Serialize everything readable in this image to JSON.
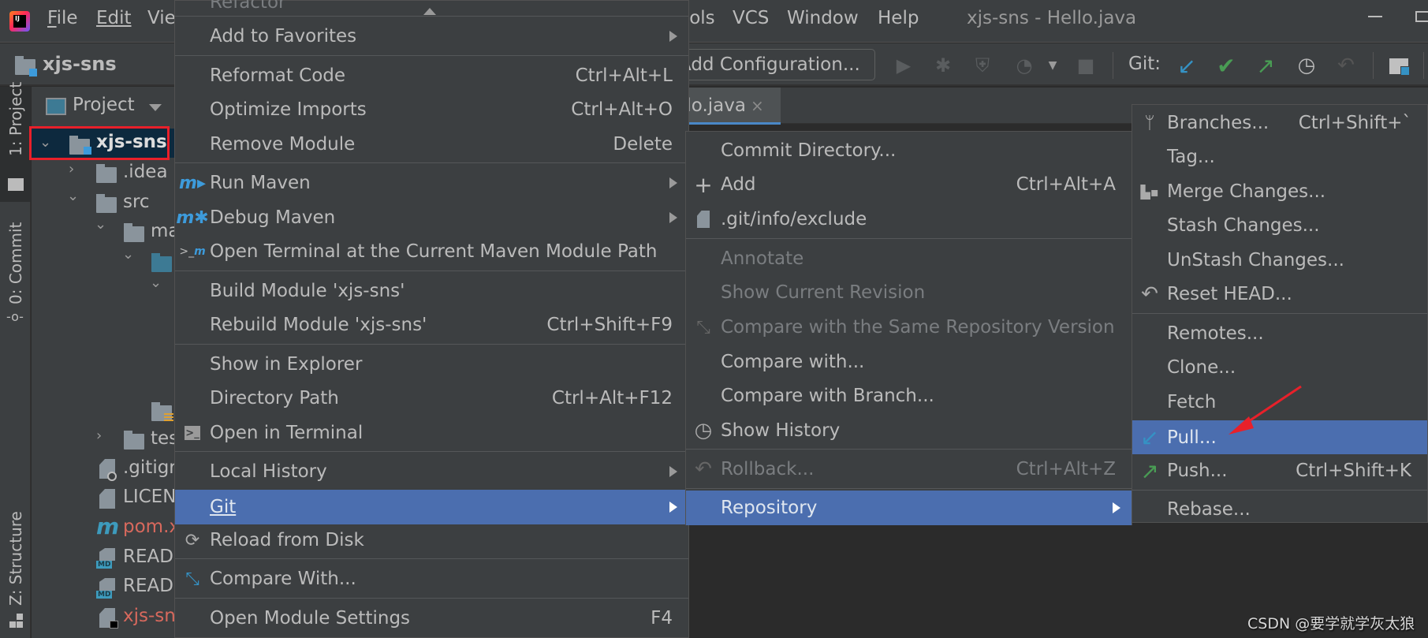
{
  "titlebar": {
    "menus": [
      {
        "label": "File",
        "mnemonic": "F"
      },
      {
        "label": "Edit",
        "mnemonic": "E"
      },
      {
        "label": "View",
        "mnemonic": "V"
      },
      {
        "label": "Tools",
        "mnemonic": "T"
      },
      {
        "label": "VCS",
        "mnemonic": "S"
      },
      {
        "label": "Window",
        "mnemonic": "W"
      },
      {
        "label": "Help",
        "mnemonic": "H"
      }
    ],
    "window_title": "xjs-sns - Hello.java"
  },
  "navbar": {
    "project_name": "xjs-sns",
    "add_configuration": "Add Configuration...",
    "git_label": "Git:"
  },
  "left_strip": {
    "project_tab": "1: Project",
    "commit_tab": "0: Commit",
    "structure_tab": "Z: Structure"
  },
  "project_panel": {
    "header": "Project",
    "root": "xjs-sns",
    "nodes": [
      {
        "label": ".idea",
        "type": "folder"
      },
      {
        "label": "src",
        "type": "folder"
      },
      {
        "label": "ma",
        "type": "folder"
      },
      {
        "label": "tes",
        "type": "folder"
      },
      {
        "label": ".gitigr",
        "type": "file"
      },
      {
        "label": "LICEN",
        "type": "file"
      },
      {
        "label": "pom.x",
        "type": "maven"
      },
      {
        "label": "READ",
        "type": "md"
      },
      {
        "label": "READ",
        "type": "md"
      },
      {
        "label": "xjs-sn",
        "type": "file"
      }
    ]
  },
  "editor": {
    "tab_label": "llo.java",
    "tab_close": "×"
  },
  "context_menu": {
    "scrolled_item": "Refactor",
    "items": [
      {
        "label": "Add to Favorites",
        "submenu": true
      },
      {
        "label": "Reformat Code",
        "shortcut": "Ctrl+Alt+L"
      },
      {
        "label": "Optimize Imports",
        "shortcut": "Ctrl+Alt+O"
      },
      {
        "label": "Remove Module",
        "shortcut": "Delete"
      },
      {
        "label": "Run Maven",
        "submenu": true,
        "icon": "maven-run-icon"
      },
      {
        "label": "Debug Maven",
        "submenu": true,
        "icon": "maven-debug-icon"
      },
      {
        "label": "Open Terminal at the Current Maven Module Path",
        "icon": "maven-terminal-icon"
      },
      {
        "label": "Build Module 'xjs-sns'"
      },
      {
        "label": "Rebuild Module 'xjs-sns'",
        "shortcut": "Ctrl+Shift+F9"
      },
      {
        "label": "Show in Explorer"
      },
      {
        "label": "Directory Path",
        "shortcut": "Ctrl+Alt+F12"
      },
      {
        "label": "Open in Terminal",
        "icon": "terminal-icon"
      },
      {
        "label": "Local History",
        "submenu": true
      },
      {
        "label": "Git",
        "submenu": true,
        "selected": true
      },
      {
        "label": "Reload from Disk",
        "icon": "reload-icon"
      },
      {
        "label": "Compare With...",
        "icon": "compare-icon"
      },
      {
        "label": "Open Module Settings",
        "shortcut": "F4"
      }
    ]
  },
  "git_menu": {
    "items": [
      {
        "label": "Commit Directory..."
      },
      {
        "label": "Add",
        "shortcut": "Ctrl+Alt+A",
        "icon": "plus-icon"
      },
      {
        "label": ".git/info/exclude",
        "icon": "ignored-file-icon"
      },
      {
        "label": "Annotate",
        "disabled": true
      },
      {
        "label": "Show Current Revision",
        "disabled": true
      },
      {
        "label": "Compare with the Same Repository Version",
        "disabled": true,
        "icon": "compare-icon"
      },
      {
        "label": "Compare with..."
      },
      {
        "label": "Compare with Branch..."
      },
      {
        "label": "Show History",
        "icon": "history-icon"
      },
      {
        "label": "Rollback...",
        "shortcut": "Ctrl+Alt+Z",
        "disabled": true,
        "icon": "rollback-icon"
      },
      {
        "label": "Repository",
        "submenu": true,
        "selected": true
      }
    ]
  },
  "repository_menu": {
    "items": [
      {
        "label": "Branches...",
        "shortcut": "Ctrl+Shift+`",
        "icon": "branch-icon"
      },
      {
        "label": "Tag..."
      },
      {
        "label": "Merge Changes...",
        "icon": "merge-icon"
      },
      {
        "label": "Stash Changes..."
      },
      {
        "label": "UnStash Changes..."
      },
      {
        "label": "Reset HEAD...",
        "icon": "reset-icon"
      },
      {
        "label": "Remotes..."
      },
      {
        "label": "Clone..."
      },
      {
        "label": "Fetch"
      },
      {
        "label": "Pull...",
        "selected": true,
        "icon": "pull-icon"
      },
      {
        "label": "Push...",
        "shortcut": "Ctrl+Shift+K",
        "icon": "push-icon"
      },
      {
        "label": "Rebase..."
      }
    ]
  },
  "colors": {
    "selection": "#4b6eaf",
    "annotation_red": "#e8202a",
    "git_pull_blue": "#3592c4",
    "git_green": "#499c54"
  },
  "watermark": "CSDN @要学就学灰太狼"
}
